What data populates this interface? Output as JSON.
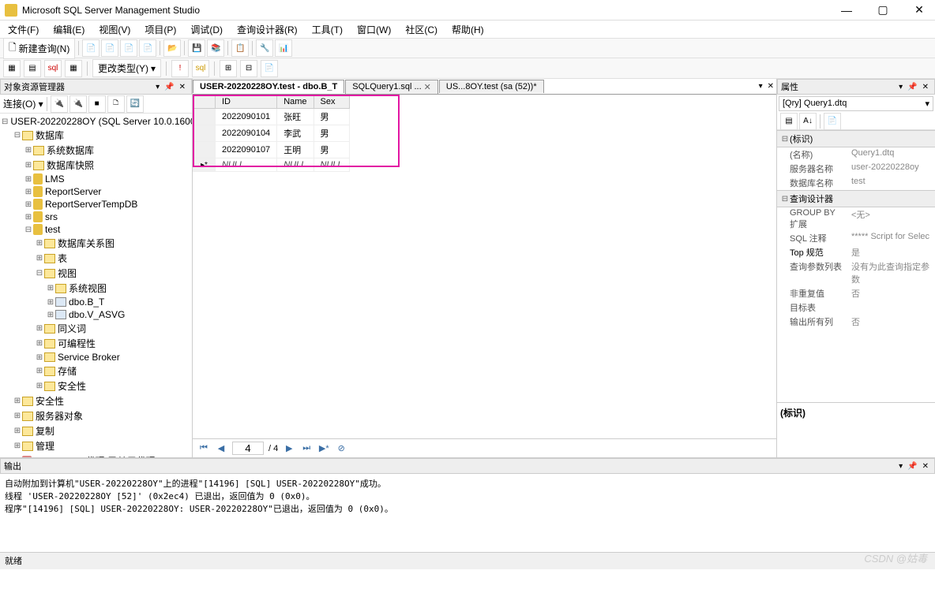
{
  "window": {
    "title": "Microsoft SQL Server Management Studio"
  },
  "menu": [
    "文件(F)",
    "编辑(E)",
    "视图(V)",
    "项目(P)",
    "调试(D)",
    "查询设计器(R)",
    "工具(T)",
    "窗口(W)",
    "社区(C)",
    "帮助(H)"
  ],
  "toolbar1": {
    "new_query": "新建查询(N)"
  },
  "toolbar2": {
    "change_type": "更改类型(Y)"
  },
  "object_explorer": {
    "title": "对象资源管理器",
    "connect_label": "连接(O)"
  },
  "tree": {
    "server": "USER-20220228OY (SQL Server 10.0.1600",
    "databases": "数据库",
    "sys_databases": "系统数据库",
    "db_snapshots": "数据库快照",
    "lms": "LMS",
    "reportserver": "ReportServer",
    "reportservertemp": "ReportServerTempDB",
    "srs": "srs",
    "test": "test",
    "db_diagrams": "数据库关系图",
    "tables": "表",
    "views": "视图",
    "sys_views": "系统视图",
    "view_bt": "dbo.B_T",
    "view_asvg": "dbo.V_ASVG",
    "synonyms": "同义词",
    "programmability": "可编程性",
    "service_broker": "Service Broker",
    "storage": "存储",
    "security_db": "安全性",
    "security": "安全性",
    "server_objects": "服务器对象",
    "replication": "复制",
    "management": "管理",
    "agent": "SQL Server 代理(已禁用代理 XP)"
  },
  "tabs": [
    {
      "label": "USER-20220228OY.test - dbo.B_T",
      "active": true
    },
    {
      "label": "SQLQuery1.sql ...",
      "active": false
    },
    {
      "label": "US...8OY.test (sa (52))*",
      "active": false
    }
  ],
  "grid": {
    "headers": [
      "ID",
      "Name",
      "Sex"
    ],
    "rows": [
      {
        "id": "2022090101",
        "name": "张旺",
        "sex": "男"
      },
      {
        "id": "2022090104",
        "name": "李武",
        "sex": "男"
      },
      {
        "id": "2022090107",
        "name": "王明",
        "sex": "男"
      }
    ],
    "null_text": "NULL",
    "new_row_marker": "▸*"
  },
  "navigator": {
    "current": "4",
    "total": "/ 4"
  },
  "properties": {
    "title": "属性",
    "dropdown": "[Qry] Query1.dtq",
    "cat_identity": "(标识)",
    "name_label": "(名称)",
    "name_val": "Query1.dtq",
    "server_label": "服务器名称",
    "server_val": "user-20220228oy",
    "db_label": "数据库名称",
    "db_val": "test",
    "cat_designer": "查询设计器",
    "groupby_label": "GROUP BY 扩展",
    "groupby_val": "<无>",
    "sqlcomment_label": "SQL 注释",
    "sqlcomment_val": "***** Script for Selec",
    "top_label": "Top 规范",
    "top_val": "是",
    "paramlist_label": "查询参数列表",
    "paramlist_val": "没有为此查询指定参数",
    "distinct_label": "非重复值",
    "distinct_val": "否",
    "target_label": "目标表",
    "target_val": "",
    "outputall_label": "输出所有列",
    "outputall_val": "否",
    "desc_title": "(标识)"
  },
  "output": {
    "title": "输出",
    "text": "自动附加到计算机\"USER-20220228OY\"上的进程\"[14196] [SQL] USER-20220228OY\"成功。\n线程 'USER-20220228OY [52]' (0x2ec4) 已退出，返回值为 0 (0x0)。\n程序\"[14196] [SQL] USER-20220228OY: USER-20220228OY\"已退出，返回值为 0 (0x0)。"
  },
  "statusbar": {
    "text": "就绪"
  },
  "watermark": "CSDN @姑毒"
}
